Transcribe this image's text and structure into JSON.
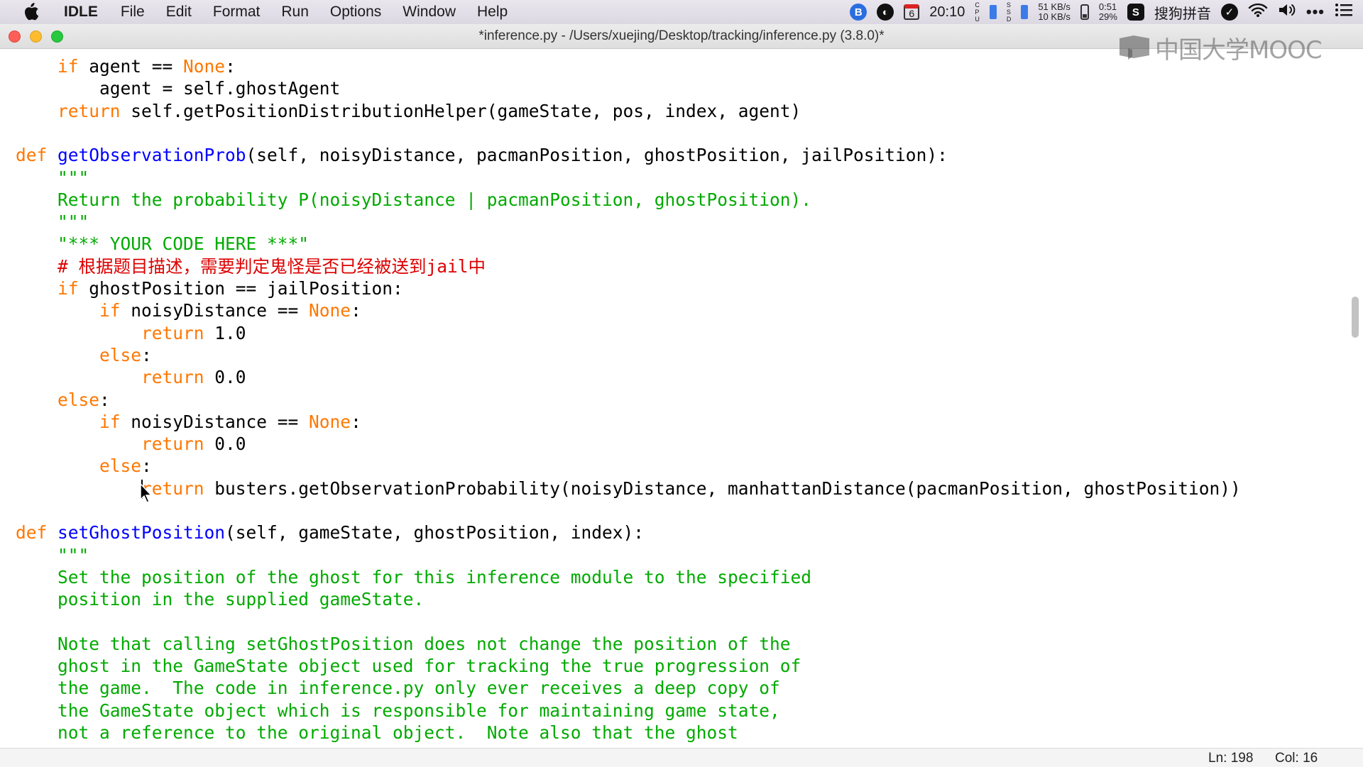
{
  "menubar": {
    "app_name": "IDLE",
    "menus": [
      "File",
      "Edit",
      "Format",
      "Run",
      "Options",
      "Window",
      "Help"
    ],
    "status": {
      "calendar_day": "6",
      "clock": "20:10",
      "net_up": "51 KB/s",
      "net_down": "10 KB/s",
      "battery_time": "0:51",
      "battery_pct": "29%",
      "input_method": "搜狗拼音"
    }
  },
  "window": {
    "title": "*inference.py - /Users/xuejing/Desktop/tracking/inference.py (3.8.0)*"
  },
  "watermark": {
    "text": "中国大学MOOC"
  },
  "statusbar": {
    "line": "Ln: 198",
    "col": "Col: 16"
  },
  "code": [
    [
      [
        "",
        "    if agent == None:"
      ]
    ],
    [
      [
        "",
        "        agent = self.ghostAgent"
      ]
    ],
    [
      [
        "",
        "    return self.getPositionDistributionHelper(gameState, pos, index, agent)"
      ]
    ],
    [],
    [
      [
        "",
        "def getObservationProb(self, noisyDistance, pacmanPosition, ghostPosition, jailPosition):"
      ]
    ],
    [
      [
        "",
        "    \"\"\""
      ]
    ],
    [
      [
        "",
        "    Return the probability P(noisyDistance | pacmanPosition, ghostPosition)."
      ]
    ],
    [
      [
        "",
        "    \"\"\""
      ]
    ],
    [
      [
        "",
        "    \"*** YOUR CODE HERE ***\""
      ]
    ],
    [
      [
        "",
        "    # 根据题目描述，需要判定鬼怪是否已经被送到jail中"
      ]
    ],
    [
      [
        "",
        "    if ghostPosition == jailPosition:"
      ]
    ],
    [
      [
        "",
        "        if noisyDistance == None:"
      ]
    ],
    [
      [
        "",
        "            return 1.0"
      ]
    ],
    [
      [
        "",
        "        else:"
      ]
    ],
    [
      [
        "",
        "            return 0.0"
      ]
    ],
    [
      [
        "",
        "    else:"
      ]
    ],
    [
      [
        "",
        "        if noisyDistance == None:"
      ]
    ],
    [
      [
        "",
        "            return 0.0"
      ]
    ],
    [
      [
        "",
        "        else:"
      ]
    ],
    [
      [
        "",
        "            return busters.getObservationProbability(noisyDistance, manhattanDistance(pacmanPosition, ghostPosition))"
      ]
    ],
    [],
    [
      [
        "",
        "def setGhostPosition(self, gameState, ghostPosition, index):"
      ]
    ],
    [
      [
        "",
        "    \"\"\""
      ]
    ],
    [
      [
        "",
        "    Set the position of the ghost for this inference module to the specified"
      ]
    ],
    [
      [
        "",
        "    position in the supplied gameState."
      ]
    ],
    [],
    [
      [
        "",
        "    Note that calling setGhostPosition does not change the position of the"
      ]
    ],
    [
      [
        "",
        "    ghost in the GameState object used for tracking the true progression of"
      ]
    ],
    [
      [
        "",
        "    the game.  The code in inference.py only ever receives a deep copy of"
      ]
    ],
    [
      [
        "",
        "    the GameState object which is responsible for maintaining game state,"
      ]
    ],
    [
      [
        "",
        "    not a reference to the original object.  Note also that the ghost"
      ]
    ]
  ],
  "colors": {
    "keyword": "#ff7700",
    "definition": "#0000ff",
    "string": "#00aa00",
    "comment": "#dd0000"
  }
}
